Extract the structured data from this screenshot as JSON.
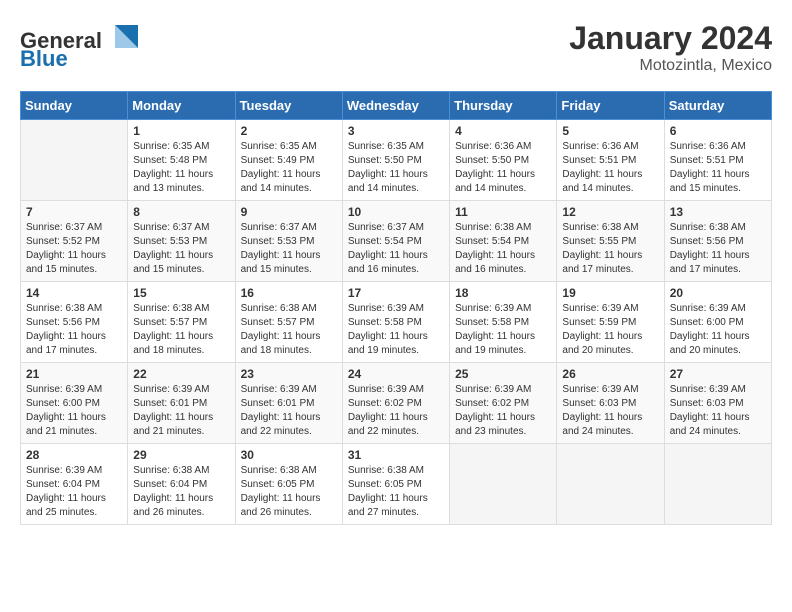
{
  "header": {
    "logo_general": "General",
    "logo_blue": "Blue",
    "month_year": "January 2024",
    "location": "Motozintla, Mexico"
  },
  "weekdays": [
    "Sunday",
    "Monday",
    "Tuesday",
    "Wednesday",
    "Thursday",
    "Friday",
    "Saturday"
  ],
  "weeks": [
    [
      {
        "day": "",
        "sunrise": "",
        "sunset": "",
        "daylight": ""
      },
      {
        "day": "1",
        "sunrise": "Sunrise: 6:35 AM",
        "sunset": "Sunset: 5:48 PM",
        "daylight": "Daylight: 11 hours and 13 minutes."
      },
      {
        "day": "2",
        "sunrise": "Sunrise: 6:35 AM",
        "sunset": "Sunset: 5:49 PM",
        "daylight": "Daylight: 11 hours and 14 minutes."
      },
      {
        "day": "3",
        "sunrise": "Sunrise: 6:35 AM",
        "sunset": "Sunset: 5:50 PM",
        "daylight": "Daylight: 11 hours and 14 minutes."
      },
      {
        "day": "4",
        "sunrise": "Sunrise: 6:36 AM",
        "sunset": "Sunset: 5:50 PM",
        "daylight": "Daylight: 11 hours and 14 minutes."
      },
      {
        "day": "5",
        "sunrise": "Sunrise: 6:36 AM",
        "sunset": "Sunset: 5:51 PM",
        "daylight": "Daylight: 11 hours and 14 minutes."
      },
      {
        "day": "6",
        "sunrise": "Sunrise: 6:36 AM",
        "sunset": "Sunset: 5:51 PM",
        "daylight": "Daylight: 11 hours and 15 minutes."
      }
    ],
    [
      {
        "day": "7",
        "sunrise": "Sunrise: 6:37 AM",
        "sunset": "Sunset: 5:52 PM",
        "daylight": "Daylight: 11 hours and 15 minutes."
      },
      {
        "day": "8",
        "sunrise": "Sunrise: 6:37 AM",
        "sunset": "Sunset: 5:53 PM",
        "daylight": "Daylight: 11 hours and 15 minutes."
      },
      {
        "day": "9",
        "sunrise": "Sunrise: 6:37 AM",
        "sunset": "Sunset: 5:53 PM",
        "daylight": "Daylight: 11 hours and 15 minutes."
      },
      {
        "day": "10",
        "sunrise": "Sunrise: 6:37 AM",
        "sunset": "Sunset: 5:54 PM",
        "daylight": "Daylight: 11 hours and 16 minutes."
      },
      {
        "day": "11",
        "sunrise": "Sunrise: 6:38 AM",
        "sunset": "Sunset: 5:54 PM",
        "daylight": "Daylight: 11 hours and 16 minutes."
      },
      {
        "day": "12",
        "sunrise": "Sunrise: 6:38 AM",
        "sunset": "Sunset: 5:55 PM",
        "daylight": "Daylight: 11 hours and 17 minutes."
      },
      {
        "day": "13",
        "sunrise": "Sunrise: 6:38 AM",
        "sunset": "Sunset: 5:56 PM",
        "daylight": "Daylight: 11 hours and 17 minutes."
      }
    ],
    [
      {
        "day": "14",
        "sunrise": "Sunrise: 6:38 AM",
        "sunset": "Sunset: 5:56 PM",
        "daylight": "Daylight: 11 hours and 17 minutes."
      },
      {
        "day": "15",
        "sunrise": "Sunrise: 6:38 AM",
        "sunset": "Sunset: 5:57 PM",
        "daylight": "Daylight: 11 hours and 18 minutes."
      },
      {
        "day": "16",
        "sunrise": "Sunrise: 6:38 AM",
        "sunset": "Sunset: 5:57 PM",
        "daylight": "Daylight: 11 hours and 18 minutes."
      },
      {
        "day": "17",
        "sunrise": "Sunrise: 6:39 AM",
        "sunset": "Sunset: 5:58 PM",
        "daylight": "Daylight: 11 hours and 19 minutes."
      },
      {
        "day": "18",
        "sunrise": "Sunrise: 6:39 AM",
        "sunset": "Sunset: 5:58 PM",
        "daylight": "Daylight: 11 hours and 19 minutes."
      },
      {
        "day": "19",
        "sunrise": "Sunrise: 6:39 AM",
        "sunset": "Sunset: 5:59 PM",
        "daylight": "Daylight: 11 hours and 20 minutes."
      },
      {
        "day": "20",
        "sunrise": "Sunrise: 6:39 AM",
        "sunset": "Sunset: 6:00 PM",
        "daylight": "Daylight: 11 hours and 20 minutes."
      }
    ],
    [
      {
        "day": "21",
        "sunrise": "Sunrise: 6:39 AM",
        "sunset": "Sunset: 6:00 PM",
        "daylight": "Daylight: 11 hours and 21 minutes."
      },
      {
        "day": "22",
        "sunrise": "Sunrise: 6:39 AM",
        "sunset": "Sunset: 6:01 PM",
        "daylight": "Daylight: 11 hours and 21 minutes."
      },
      {
        "day": "23",
        "sunrise": "Sunrise: 6:39 AM",
        "sunset": "Sunset: 6:01 PM",
        "daylight": "Daylight: 11 hours and 22 minutes."
      },
      {
        "day": "24",
        "sunrise": "Sunrise: 6:39 AM",
        "sunset": "Sunset: 6:02 PM",
        "daylight": "Daylight: 11 hours and 22 minutes."
      },
      {
        "day": "25",
        "sunrise": "Sunrise: 6:39 AM",
        "sunset": "Sunset: 6:02 PM",
        "daylight": "Daylight: 11 hours and 23 minutes."
      },
      {
        "day": "26",
        "sunrise": "Sunrise: 6:39 AM",
        "sunset": "Sunset: 6:03 PM",
        "daylight": "Daylight: 11 hours and 24 minutes."
      },
      {
        "day": "27",
        "sunrise": "Sunrise: 6:39 AM",
        "sunset": "Sunset: 6:03 PM",
        "daylight": "Daylight: 11 hours and 24 minutes."
      }
    ],
    [
      {
        "day": "28",
        "sunrise": "Sunrise: 6:39 AM",
        "sunset": "Sunset: 6:04 PM",
        "daylight": "Daylight: 11 hours and 25 minutes."
      },
      {
        "day": "29",
        "sunrise": "Sunrise: 6:38 AM",
        "sunset": "Sunset: 6:04 PM",
        "daylight": "Daylight: 11 hours and 26 minutes."
      },
      {
        "day": "30",
        "sunrise": "Sunrise: 6:38 AM",
        "sunset": "Sunset: 6:05 PM",
        "daylight": "Daylight: 11 hours and 26 minutes."
      },
      {
        "day": "31",
        "sunrise": "Sunrise: 6:38 AM",
        "sunset": "Sunset: 6:05 PM",
        "daylight": "Daylight: 11 hours and 27 minutes."
      },
      {
        "day": "",
        "sunrise": "",
        "sunset": "",
        "daylight": ""
      },
      {
        "day": "",
        "sunrise": "",
        "sunset": "",
        "daylight": ""
      },
      {
        "day": "",
        "sunrise": "",
        "sunset": "",
        "daylight": ""
      }
    ]
  ]
}
